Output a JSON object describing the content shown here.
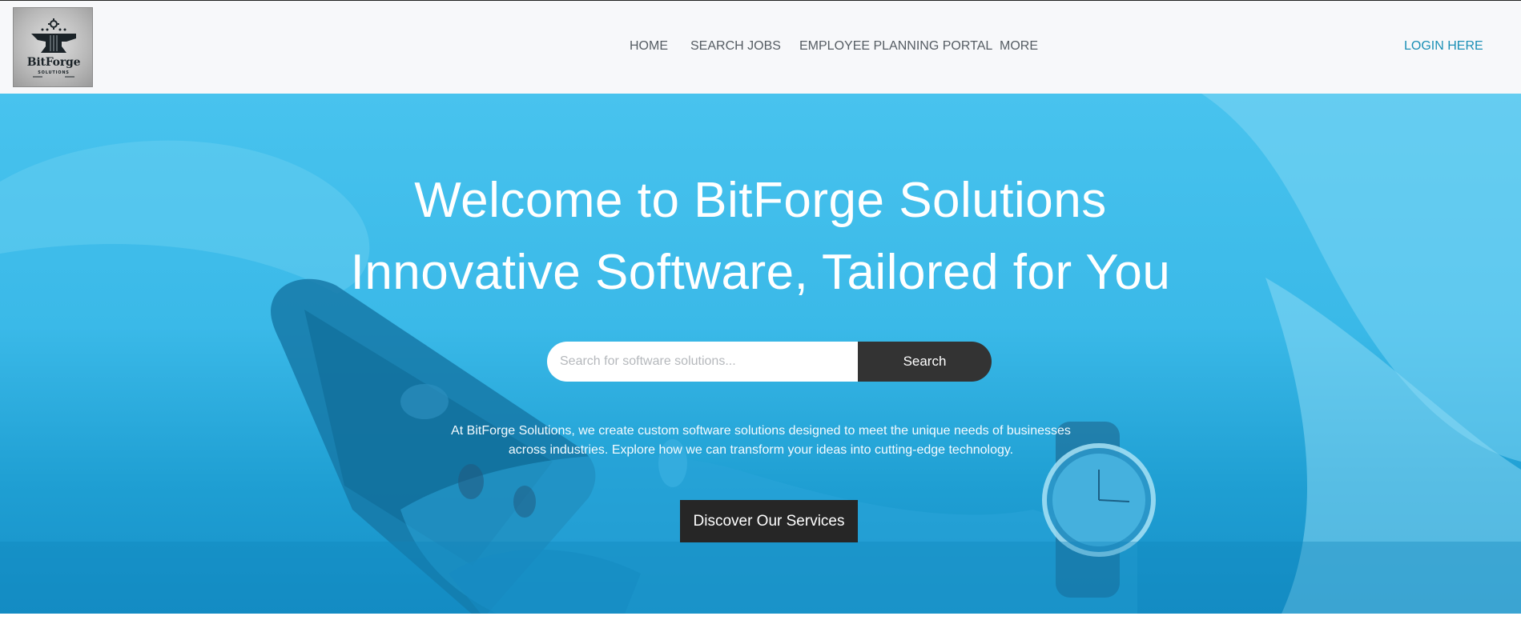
{
  "brand": {
    "logo_name": "BitForge",
    "logo_sub": "SOLUTIONS",
    "icon": "anvil-gear-logo"
  },
  "nav": {
    "items": [
      {
        "label": "HOME"
      },
      {
        "label": "SEARCH JOBS"
      },
      {
        "label": "EMPLOYEE PLANNING PORTAL"
      },
      {
        "label": "MORE"
      }
    ],
    "login_label": "LOGIN HERE"
  },
  "hero": {
    "title": "Welcome to BitForge Solutions",
    "subtitle": "Innovative Software, Tailored for You",
    "search_placeholder": "Search for software solutions...",
    "search_value": "",
    "search_button": "Search",
    "description": "At BitForge Solutions, we create custom software solutions designed to meet the unique needs of businesses across industries. Explore how we can transform your ideas into cutting-edge technology.",
    "cta_label": "Discover Our Services"
  },
  "colors": {
    "header_bg": "#f7f8fa",
    "hero_bg": "#3ab9e8",
    "nav_text": "#555c63",
    "login_link": "#1a8fb5",
    "search_button_bg": "#333333",
    "cta_bg": "#262626"
  }
}
